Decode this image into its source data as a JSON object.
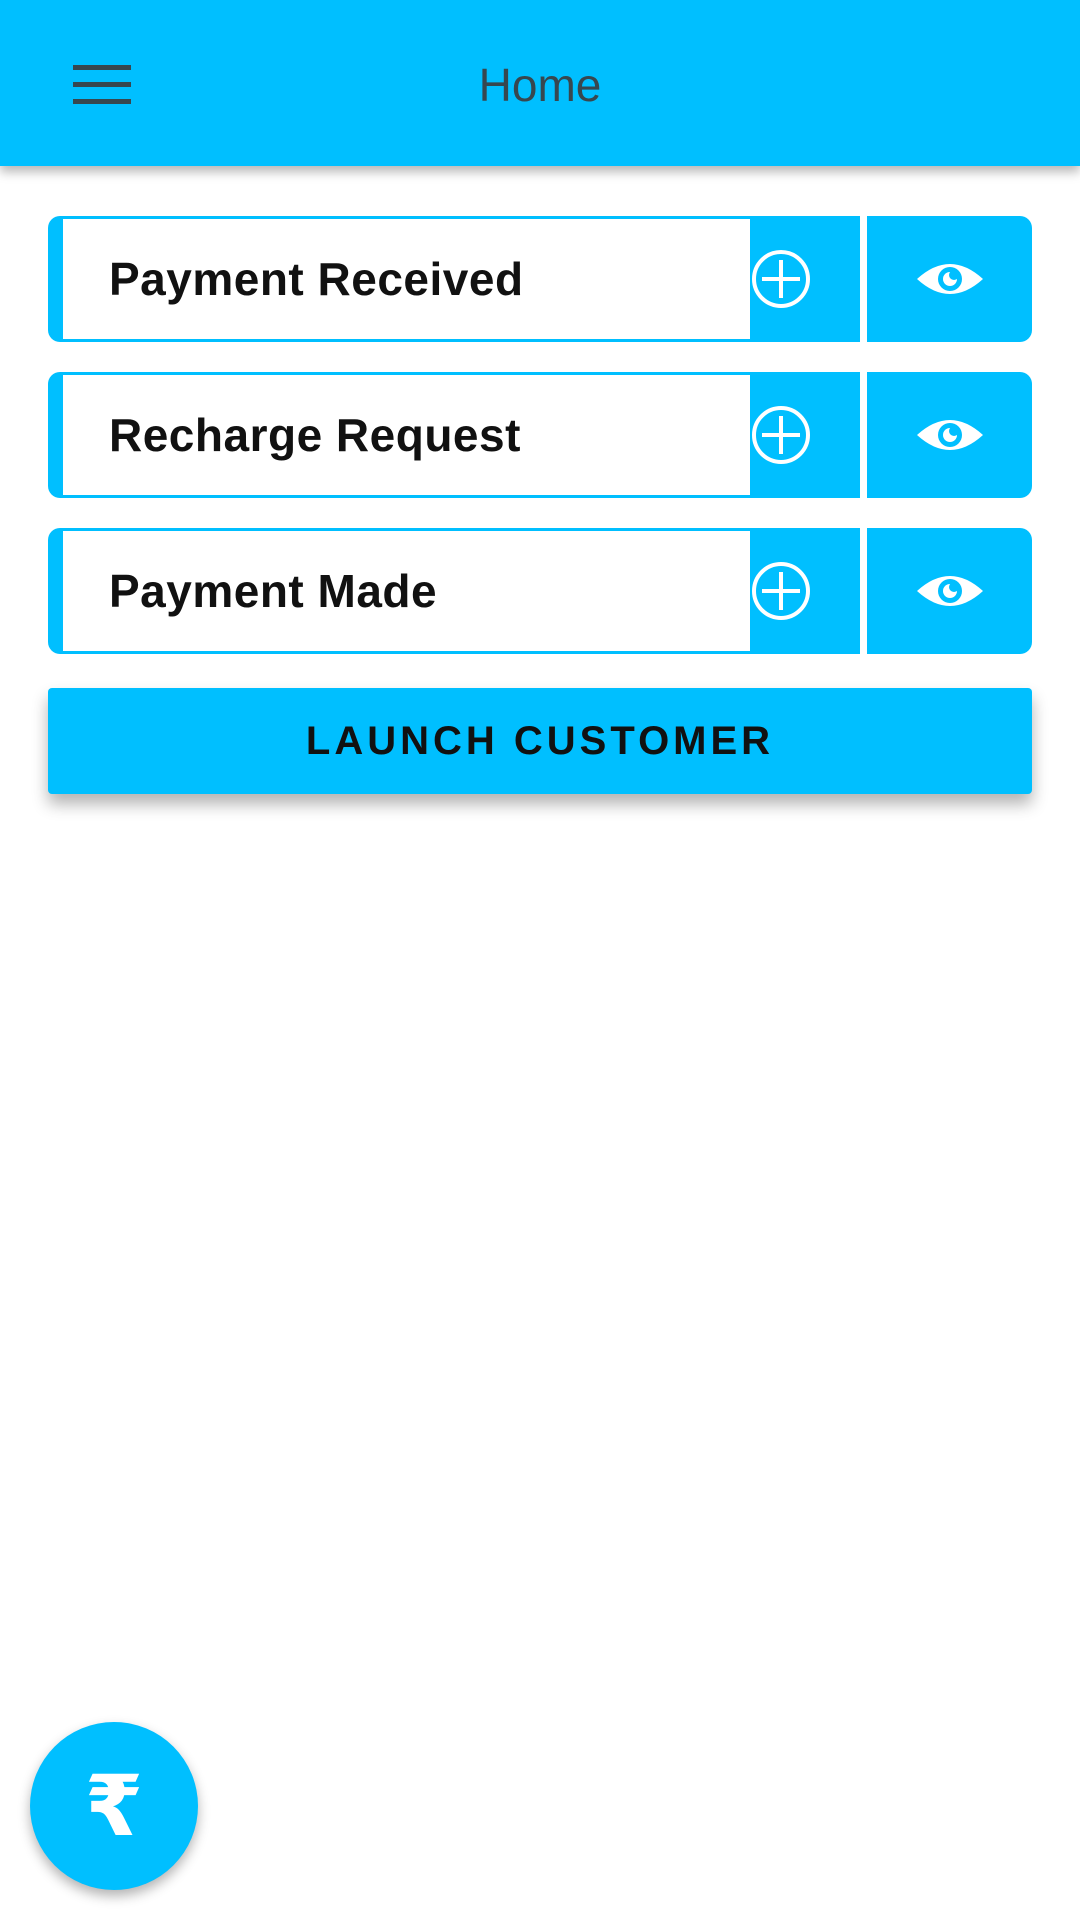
{
  "appbar": {
    "title": "Home",
    "menu_icon": "hamburger-menu-icon"
  },
  "rows": [
    {
      "label": "Payment Received",
      "add_icon": "circle-plus-icon",
      "view_icon": "eye-icon"
    },
    {
      "label": "Recharge Request",
      "add_icon": "circle-plus-icon",
      "view_icon": "eye-icon"
    },
    {
      "label": "Payment Made",
      "add_icon": "circle-plus-icon",
      "view_icon": "eye-icon"
    }
  ],
  "launch_button": {
    "label": "LAUNCH CUSTOMER"
  },
  "fab": {
    "glyph": "₹",
    "icon": "rupee-icon"
  },
  "colors": {
    "primary": "#00BFFF",
    "title_text": "#37474F",
    "label_text": "#111111",
    "background": "#FFFFFF"
  }
}
